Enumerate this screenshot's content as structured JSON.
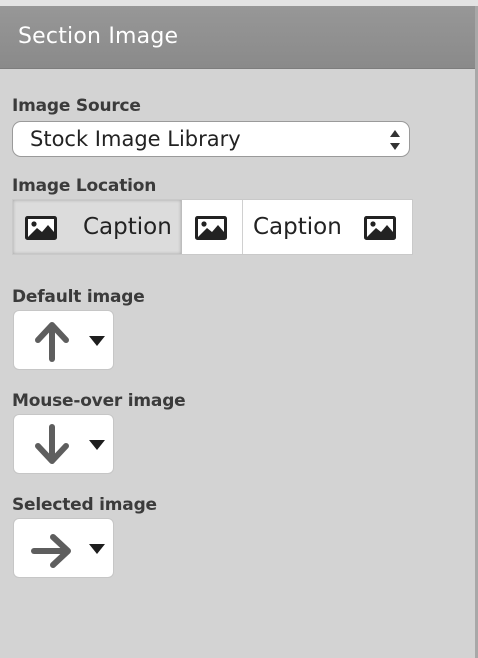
{
  "header": {
    "title": "Section Image"
  },
  "image_source": {
    "label": "Image Source",
    "value": "Stock Image Library"
  },
  "image_location": {
    "label": "Image Location",
    "options": [
      {
        "icon": "image-icon",
        "caption": "Caption",
        "selected": true
      },
      {
        "icon": "image-icon",
        "caption": "",
        "selected": false
      },
      {
        "icon": "image-icon",
        "caption": "Caption",
        "selected": false
      }
    ]
  },
  "default_image": {
    "label": "Default image",
    "icon": "arrow-up-icon"
  },
  "mouseover_image": {
    "label": "Mouse-over image",
    "icon": "arrow-down-icon"
  },
  "selected_image": {
    "label": "Selected image",
    "icon": "arrow-right-icon"
  }
}
